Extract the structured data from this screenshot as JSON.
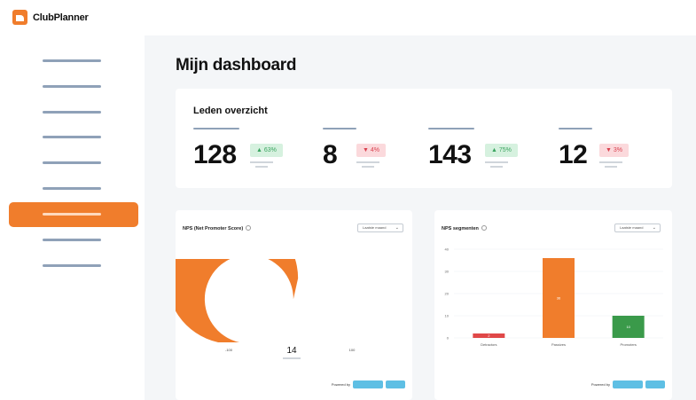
{
  "app": {
    "name": "ClubPlanner"
  },
  "page": {
    "title": "Mijn dashboard"
  },
  "overview": {
    "title": "Leden overzicht",
    "stats": [
      {
        "value": "128",
        "change": "▲ 63%",
        "trend": "up"
      },
      {
        "value": "8",
        "change": "▼ 4%",
        "trend": "down"
      },
      {
        "value": "143",
        "change": "▲ 75%",
        "trend": "up"
      },
      {
        "value": "12",
        "change": "▼ 3%",
        "trend": "down"
      }
    ]
  },
  "nps": {
    "title": "NPS (Net Promoter Score)",
    "filter": "Laatste maand",
    "score": "14",
    "gauge_left": "-100",
    "gauge_right": "100",
    "gauge_fill_fraction": 0.57,
    "powered_by": "Powered by"
  },
  "segments": {
    "title": "NPS segmenten",
    "filter": "Laatste maand",
    "powered_by": "Powered by"
  },
  "colors": {
    "accent": "#f07d2c",
    "detractors": "#e04848",
    "passives": "#f07d2c",
    "promoters": "#3a9a4a",
    "badge_up": "#d6f1df",
    "badge_down": "#fbd9dc",
    "powered_by": "#5ebfe4"
  },
  "chart_data": {
    "type": "bar",
    "categories": [
      "Detractors",
      "Passives",
      "Promoters"
    ],
    "values": [
      2,
      36,
      10
    ],
    "data_labels": [
      "2",
      "36",
      "10"
    ],
    "yticks": [
      "0",
      "10",
      "20",
      "30",
      "40"
    ],
    "ylim": [
      0,
      40
    ]
  }
}
